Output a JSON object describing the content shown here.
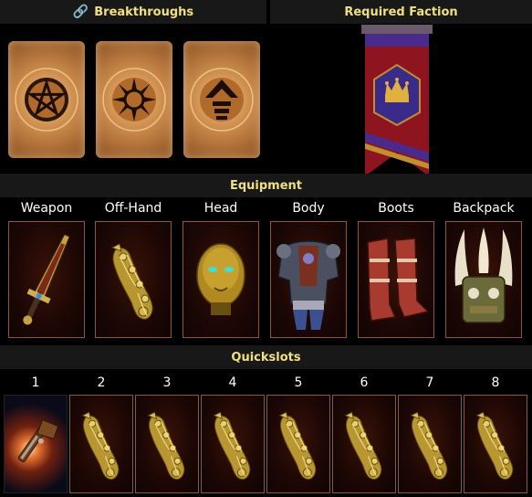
{
  "breakthroughs": {
    "title": "Breakthroughs",
    "cards": [
      {
        "icon": "pentagram-icon"
      },
      {
        "icon": "sun-icon"
      },
      {
        "icon": "arrow-up-icon"
      }
    ]
  },
  "faction": {
    "title": "Required Faction",
    "banner_icon": "crown-banner-icon"
  },
  "equipment": {
    "title": "Equipment",
    "slots": [
      {
        "label": "Weapon",
        "icon": "sword-icon"
      },
      {
        "label": "Off-Hand",
        "icon": "gauntlet-icon"
      },
      {
        "label": "Head",
        "icon": "golden-mask-icon"
      },
      {
        "label": "Body",
        "icon": "armor-icon"
      },
      {
        "label": "Boots",
        "icon": "boots-icon"
      },
      {
        "label": "Backpack",
        "icon": "horned-backpack-icon"
      }
    ]
  },
  "quickslots": {
    "title": "Quickslots",
    "slots": [
      {
        "number": "1",
        "icon": "pistol-icon"
      },
      {
        "number": "2",
        "icon": "gauntlet-icon"
      },
      {
        "number": "3",
        "icon": "gauntlet-icon"
      },
      {
        "number": "4",
        "icon": "gauntlet-icon"
      },
      {
        "number": "5",
        "icon": "gauntlet-icon"
      },
      {
        "number": "6",
        "icon": "gauntlet-icon"
      },
      {
        "number": "7",
        "icon": "gauntlet-icon"
      },
      {
        "number": "8",
        "icon": "gauntlet-icon"
      }
    ]
  },
  "colors": {
    "header_text": "#f0e080",
    "header_bg": "#181818",
    "slot_border": "#8a5a3a",
    "banner_red": "#8e1420",
    "banner_purple": "#4a2a8a",
    "gold": "#e0b040"
  }
}
